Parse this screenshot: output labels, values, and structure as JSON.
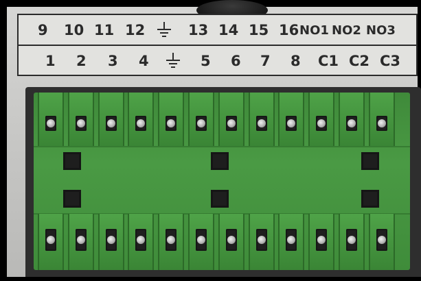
{
  "labels": {
    "top_row": [
      "9",
      "10",
      "11",
      "12",
      "13",
      "14",
      "15",
      "16",
      "NO1",
      "NO2",
      "NO3"
    ],
    "bottom_row": [
      "1",
      "2",
      "3",
      "4",
      "5",
      "6",
      "7",
      "8",
      "C1",
      "C2",
      "C3"
    ]
  },
  "icons": {
    "ground": "ground-icon"
  },
  "colors": {
    "terminal_block": "#4a9a44",
    "panel": "#c5c5c3",
    "label_text": "#2b2b2b"
  }
}
